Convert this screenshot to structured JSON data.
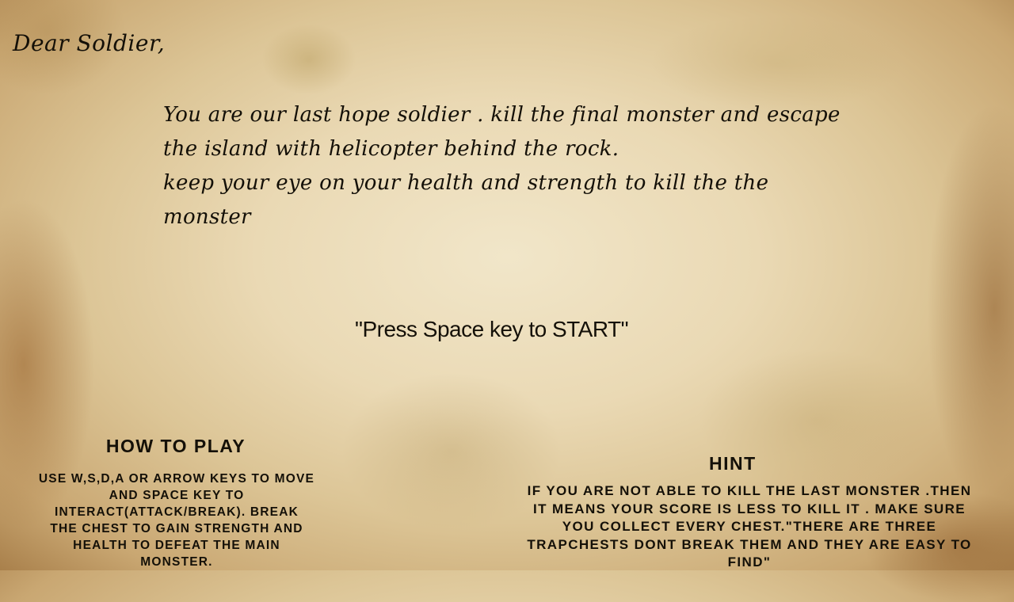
{
  "letter": {
    "greeting": "Dear Soldier,",
    "body_lines": [
      "You are our last hope soldier . kill the final monster and escape",
      "the island with helicopter behind the rock.",
      "keep your eye on your health and strength to kill the the",
      "monster"
    ]
  },
  "start_prompt": "\"Press Space key to START\"",
  "how_to_play": {
    "title": "HOW TO PLAY",
    "lines": [
      "USE W,S,D,A OR ARROW KEYS TO MOVE",
      "AND SPACE KEY TO",
      "INTERACT(ATTACK/BREAK). BREAK",
      "THE CHEST TO GAIN STRENGTH AND",
      "HEALTH TO DEFEAT THE MAIN",
      "MONSTER."
    ]
  },
  "hint": {
    "title": "HINT",
    "lines": [
      "IF YOU ARE NOT ABLE TO KILL THE LAST MONSTER .THEN",
      "IT MEANS YOUR SCORE IS LESS TO KILL IT . MAKE SURE",
      "YOU COLLECT EVERY  CHEST.\"THERE ARE THREE",
      "TRAPCHESTS DONT BREAK THEM AND THEY ARE EASY TO",
      "FIND\""
    ]
  },
  "colors": {
    "ink": "#141008",
    "parchment": "#ead9b4",
    "stain": "#a9804b"
  }
}
